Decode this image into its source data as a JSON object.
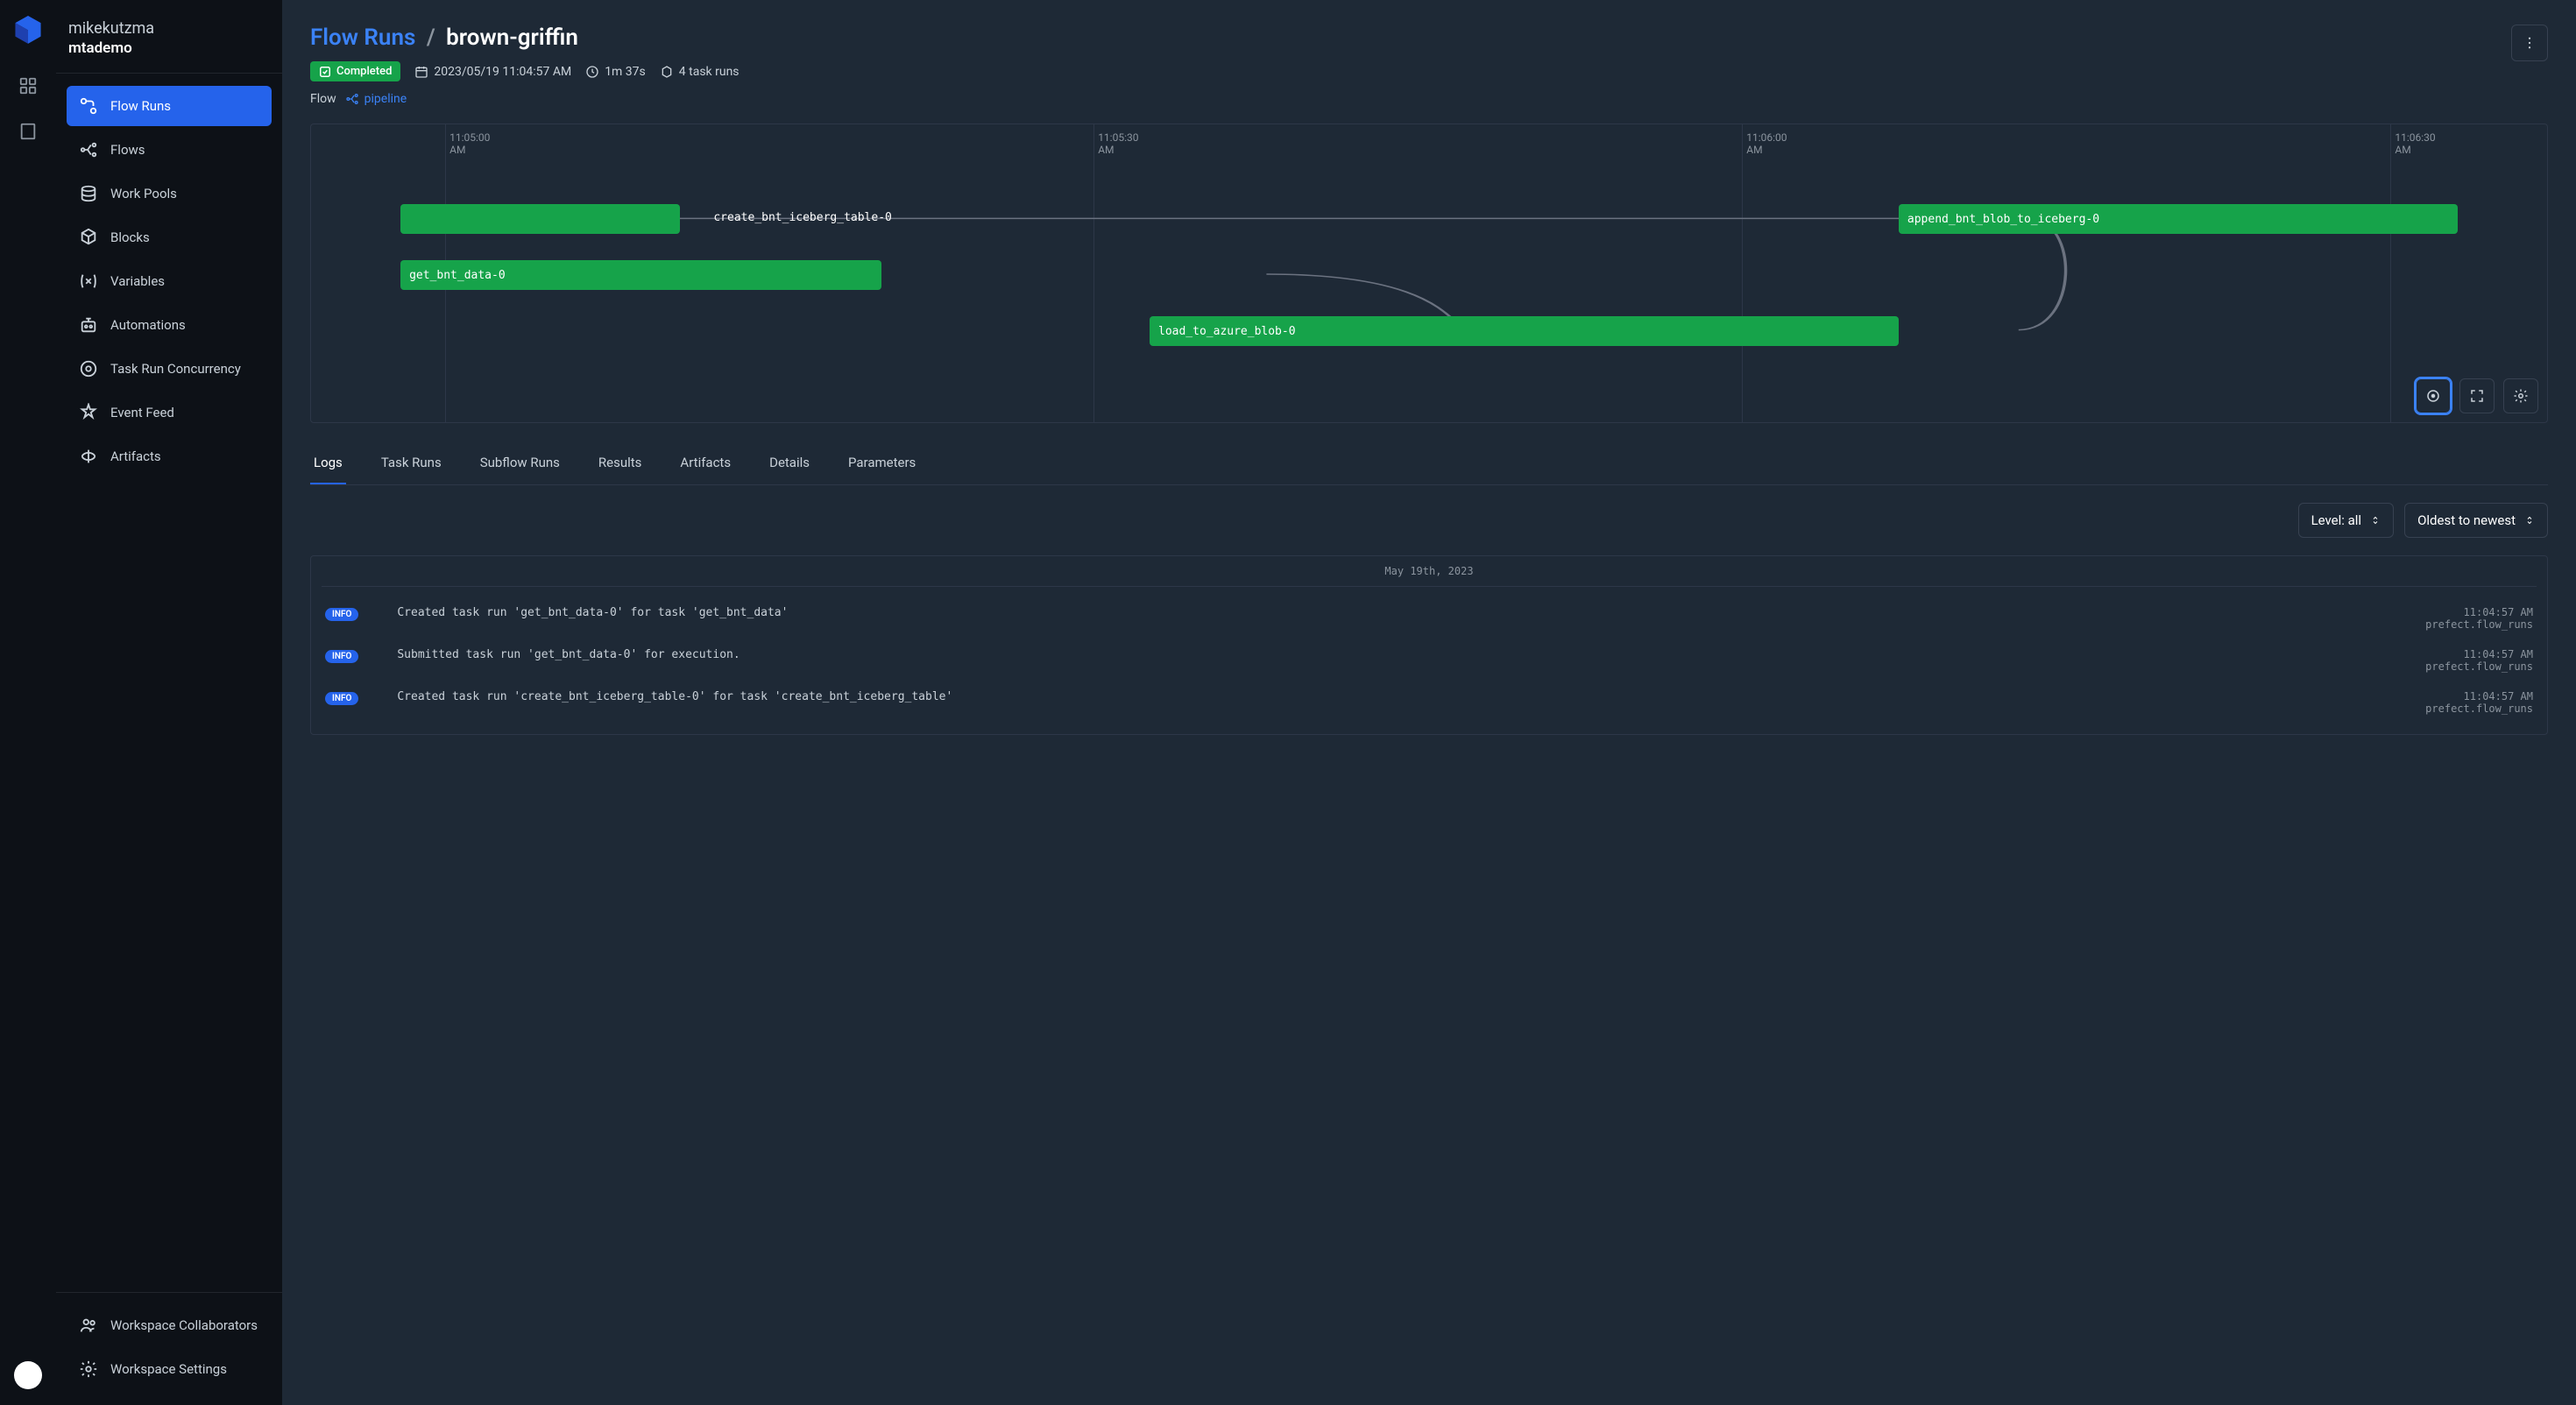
{
  "sidebar": {
    "user": "mikekutzma",
    "workspace": "mtademo",
    "nav": [
      {
        "key": "flow-runs",
        "label": "Flow Runs",
        "active": true
      },
      {
        "key": "flows",
        "label": "Flows"
      },
      {
        "key": "work-pools",
        "label": "Work Pools"
      },
      {
        "key": "blocks",
        "label": "Blocks"
      },
      {
        "key": "variables",
        "label": "Variables"
      },
      {
        "key": "automations",
        "label": "Automations"
      },
      {
        "key": "task-run-concurrency",
        "label": "Task Run Concurrency"
      },
      {
        "key": "event-feed",
        "label": "Event Feed"
      },
      {
        "key": "artifacts",
        "label": "Artifacts"
      }
    ],
    "footer": [
      {
        "key": "workspace-collaborators",
        "label": "Workspace Collaborators"
      },
      {
        "key": "workspace-settings",
        "label": "Workspace Settings"
      }
    ]
  },
  "header": {
    "breadcrumb_root": "Flow Runs",
    "breadcrumb_sep": "/",
    "breadcrumb_current": "brown-griffin",
    "status": "Completed",
    "timestamp": "2023/05/19 11:04:57 AM",
    "duration": "1m 37s",
    "task_runs": "4 task runs",
    "flow_label": "Flow",
    "flow_name": "pipeline"
  },
  "gantt": {
    "ticks": [
      "11:05:00 AM",
      "11:05:30 AM",
      "11:06:00 AM",
      "11:06:30 AM"
    ],
    "tasks": [
      {
        "name": "create_bnt_iceberg_table-0"
      },
      {
        "name": "append_bnt_blob_to_iceberg-0"
      },
      {
        "name": "get_bnt_data-0"
      },
      {
        "name": "load_to_azure_blob-0"
      }
    ]
  },
  "tabs": [
    {
      "key": "logs",
      "label": "Logs",
      "active": true
    },
    {
      "key": "task-runs",
      "label": "Task Runs"
    },
    {
      "key": "subflow-runs",
      "label": "Subflow Runs"
    },
    {
      "key": "results",
      "label": "Results"
    },
    {
      "key": "artifacts",
      "label": "Artifacts"
    },
    {
      "key": "details",
      "label": "Details"
    },
    {
      "key": "parameters",
      "label": "Parameters"
    }
  ],
  "log_controls": {
    "level": "Level: all",
    "sort": "Oldest to newest"
  },
  "logs": {
    "date": "May 19th, 2023",
    "entries": [
      {
        "level": "INFO",
        "msg": "Created task run 'get_bnt_data-0' for task 'get_bnt_data'",
        "time": "11:04:57 AM",
        "src": "prefect.flow_runs"
      },
      {
        "level": "INFO",
        "msg": "Submitted task run 'get_bnt_data-0' for execution.",
        "time": "11:04:57 AM",
        "src": "prefect.flow_runs"
      },
      {
        "level": "INFO",
        "msg": "Created task run 'create_bnt_iceberg_table-0' for task 'create_bnt_iceberg_table'",
        "time": "11:04:57 AM",
        "src": "prefect.flow_runs"
      }
    ]
  }
}
